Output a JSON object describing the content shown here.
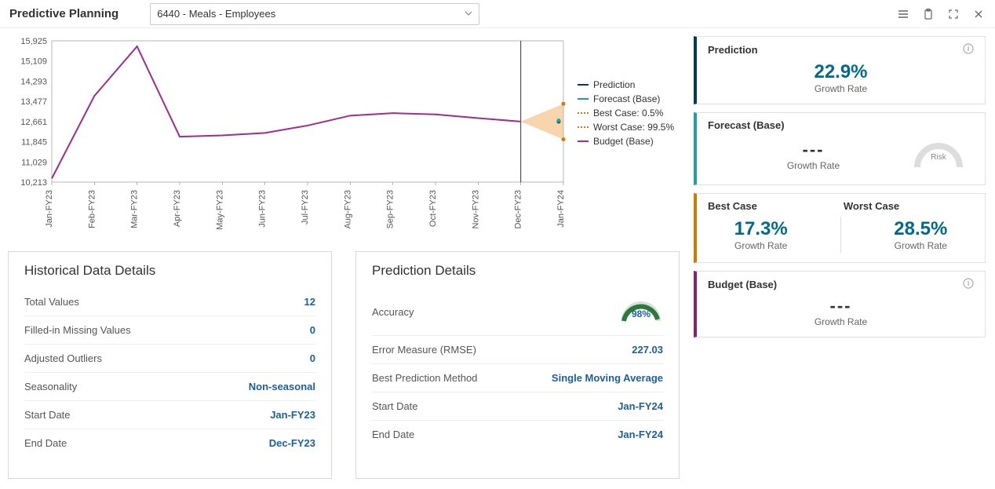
{
  "header": {
    "title": "Predictive Planning",
    "dropdown_value": "6440 - Meals - Employees"
  },
  "legend": {
    "prediction": "Prediction",
    "forecast": "Forecast (Base)",
    "best": "Best Case: 0.5%",
    "worst": "Worst Case: 99.5%",
    "budget": "Budget (Base)"
  },
  "historical": {
    "title": "Historical Data Details",
    "total_values_label": "Total Values",
    "total_values": "12",
    "filled_label": "Filled-in Missing Values",
    "filled": "0",
    "adjusted_label": "Adjusted Outliers",
    "adjusted": "0",
    "seasonality_label": "Seasonality",
    "seasonality": "Non-seasonal",
    "start_label": "Start Date",
    "start": "Jan-FY23",
    "end_label": "End Date",
    "end": "Dec-FY23"
  },
  "prediction_details": {
    "title": "Prediction Details",
    "accuracy_label": "Accuracy",
    "accuracy": "98%",
    "error_label": "Error Measure (RMSE)",
    "error": "227.03",
    "method_label": "Best Prediction Method",
    "method": "Single Moving Average",
    "start_label": "Start Date",
    "start": "Jan-FY24",
    "end_label": "End Date",
    "end": "Jan-FY24"
  },
  "cards": {
    "prediction_title": "Prediction",
    "prediction_val": "22.9%",
    "growth_rate": "Growth Rate",
    "forecast_title": "Forecast (Base)",
    "forecast_val": "---",
    "risk_label": "Risk",
    "best_title": "Best Case",
    "best_val": "17.3%",
    "worst_title": "Worst Case",
    "worst_val": "28.5%",
    "budget_title": "Budget (Base)",
    "budget_val": "---"
  },
  "chart_data": {
    "type": "line",
    "xlabel": "",
    "ylabel": "",
    "y_ticks": [
      10213,
      11029,
      11845,
      12661,
      13477,
      14293,
      15109,
      15925
    ],
    "categories": [
      "Jan-FY23",
      "Feb-FY23",
      "Mar-FY23",
      "Apr-FY23",
      "May-FY23",
      "Jun-FY23",
      "Jul-FY23",
      "Aug-FY23",
      "Sep-FY23",
      "Oct-FY23",
      "Nov-FY23",
      "Dec-FY23",
      "Jan-FY24"
    ],
    "prediction_divider_at": "Dec-FY23",
    "series": [
      {
        "name": "Budget (Base)",
        "color": "#8a1f7a",
        "values": [
          10360,
          13700,
          15700,
          12050,
          12100,
          12200,
          12500,
          12900,
          13000,
          12950,
          12800,
          12660,
          null
        ]
      }
    ],
    "prediction_fan": {
      "x": "Jan-FY24",
      "prediction": 12660,
      "forecast": 12700,
      "best_case": 13380,
      "worst_case": 11940
    }
  }
}
